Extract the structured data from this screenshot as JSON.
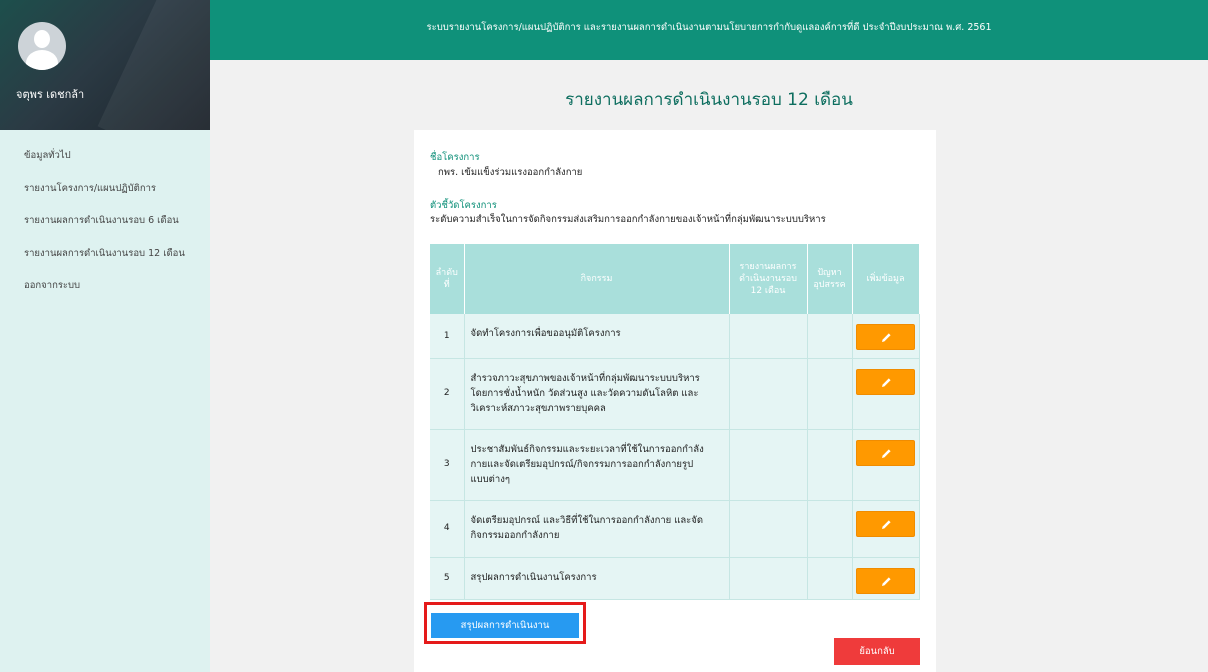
{
  "header": {
    "banner": "ระบบรายงานโครงการ/แผนปฏิบัติการ และรายงานผลการดำเนินงานตามนโยบายการกำกับดูแลองค์การที่ดี ประจำปีงบประมาณ พ.ศ. 2561"
  },
  "sidebar": {
    "username": "จตุพร เดชกล้า",
    "items": [
      {
        "label": "ข้อมูลทั่วไป"
      },
      {
        "label": "รายงานโครงการ/แผนปฏิบัติการ"
      },
      {
        "label": "รายงานผลการดำเนินงานรอบ 6 เดือน"
      },
      {
        "label": "รายงานผลการดำเนินงานรอบ 12 เดือน"
      },
      {
        "label": "ออกจากระบบ"
      }
    ]
  },
  "page": {
    "title": "รายงานผลการดำเนินงานรอบ 12 เดือน",
    "project_label": "ชื่อโครงการ",
    "project_name": "กพร. เข้มแข็งร่วมแรงออกกำลังกาย",
    "indicator_label": "ตัวชี้วัดโครงการ",
    "indicator_value": "ระดับความสำเร็จในการจัดกิจกรรมส่งเสริมการออกกำลังกายของเจ้าหน้าที่กลุ่มพัฒนาระบบบริหาร"
  },
  "table": {
    "headers": {
      "no_line1": "ลำดับ",
      "no_line2": "ที่",
      "activity": "กิจกรรม",
      "report_line1": "รายงานผลการ",
      "report_line2": "ดำเนินงานรอบ",
      "report_line3": "12 เดือน",
      "problem_line1": "ปัญหา",
      "problem_line2": "อุปสรรค",
      "add": "เพิ่มข้อมูล"
    },
    "rows": [
      {
        "no": "1",
        "l1": "จัดทำโครงการเพื่อขออนุมัติโครงการ",
        "l2": "",
        "l3": ""
      },
      {
        "no": "2",
        "l1": "สำรวจภาวะสุขภาพของเจ้าหน้าที่กลุ่มพัฒนาระบบบริหาร",
        "l2": "โดยการชั่งน้ำหนัก วัดส่วนสูง และวัดความดันโลหิต และ",
        "l3": "วิเคราะห์สภาวะสุขภาพรายบุคคล"
      },
      {
        "no": "3",
        "l1": "ประชาสัมพันธ์กิจกรรมและระยะเวลาที่ใช้ในการออกกำลัง",
        "l2": "กายและจัดเตรียมอุปกรณ์/กิจกรรมการออกกำลังกายรูป",
        "l3": "แบบต่างๆ"
      },
      {
        "no": "4",
        "l1": "จัดเตรียมอุปกรณ์ และวิธีที่ใช้ในการออกกำลังกาย และจัด",
        "l2": "กิจกรรมออกกำลังกาย",
        "l3": ""
      },
      {
        "no": "5",
        "l1": "สรุปผลการดำเนินงานโครงการ",
        "l2": "",
        "l3": ""
      }
    ]
  },
  "buttons": {
    "summary": "สรุปผลการดำเนินงาน",
    "back": "ย้อนกลับ"
  },
  "colors": {
    "topbar": "#0f917a",
    "edit": "#ff9900",
    "summary": "#279af1",
    "back": "#ef3b3b",
    "highlight": "#e51a1a"
  }
}
